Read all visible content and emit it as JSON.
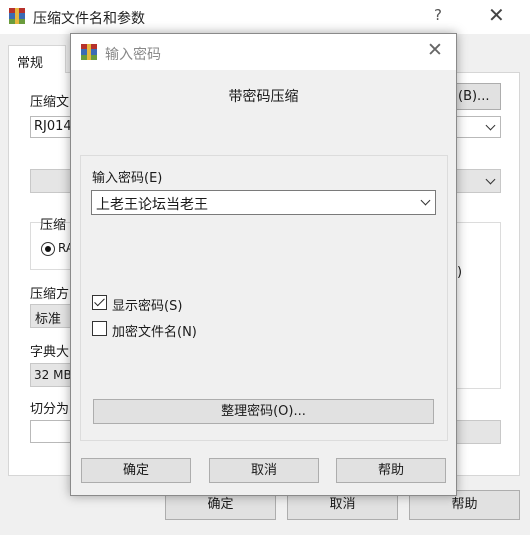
{
  "background_window": {
    "title": "压缩文件名和参数",
    "help_glyph": "?",
    "close_glyph": "✕",
    "tab_general": "常规",
    "archive_name_label": "压缩文",
    "archive_name_value": "RJ014C",
    "browse_button": "(B)...",
    "format_label": "压缩",
    "format_option": "RA",
    "format_right_fragment": ")",
    "method_label": "压缩方",
    "method_value": "标准",
    "dictionary_label": "字典大",
    "dictionary_value": "32 MB",
    "split_label": "切分为",
    "ok_button": "确定",
    "cancel_button": "取消",
    "help_button": "帮助"
  },
  "dialog": {
    "title": "输入密码",
    "close_glyph": "✕",
    "subtitle": "带密码压缩",
    "password_label": "输入密码(E)",
    "password_value": "上老王论坛当老王",
    "show_password_label": "显示密码(S)",
    "show_password_checked": true,
    "encrypt_filenames_label": "加密文件名(N)",
    "encrypt_filenames_checked": false,
    "organize_button": "整理密码(O)...",
    "ok_button": "确定",
    "cancel_button": "取消",
    "help_button": "帮助"
  }
}
